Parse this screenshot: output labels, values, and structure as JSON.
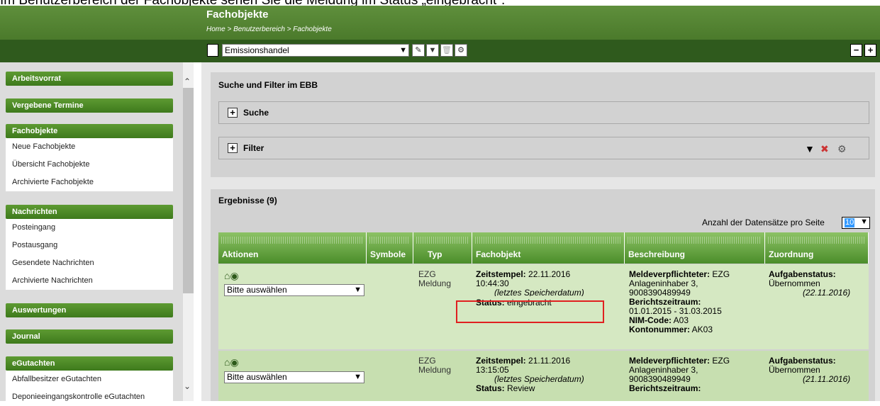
{
  "caption": "Im Benutzerbereich der Fachobjekte sehen Sie die Meldung im Status „eingebracht\".",
  "header": {
    "title": "Fachobjekte",
    "breadcrumb": "Home > Benutzerbereich > Fachobjekte"
  },
  "toolbar": {
    "selected": "Emissionshandel",
    "icons": [
      "document-icon",
      "edit-icon",
      "filter-icon",
      "trash-icon",
      "settings-icon"
    ],
    "right_icons": [
      "collapse-all-icon",
      "expand-all-icon"
    ]
  },
  "sidebar": {
    "groups": [
      {
        "title": "Arbeitsvorrat",
        "items": []
      },
      {
        "title": "Vergebene Termine",
        "items": []
      },
      {
        "title": "Fachobjekte",
        "items": [
          "Neue Fachobjekte",
          "Übersicht Fachobjekte",
          "Archivierte Fachobjekte"
        ]
      },
      {
        "title": "Nachrichten",
        "items": [
          "Posteingang",
          "Postausgang",
          "Gesendete Nachrichten",
          "Archivierte Nachrichten"
        ]
      },
      {
        "title": "Auswertungen",
        "items": []
      },
      {
        "title": "Journal",
        "items": []
      },
      {
        "title": "eGutachten",
        "items": [
          "Abfallbesitzer eGutachten",
          "Deponieeingangskontrolle eGutachten"
        ]
      }
    ]
  },
  "search_panel": {
    "title": "Suche und Filter im EBB",
    "search_label": "Suche",
    "filter_label": "Filter"
  },
  "results": {
    "title": "Ergebnisse (9)",
    "per_page_label": "Anzahl der Datensätze pro Seite",
    "per_page_value": "10",
    "columns": [
      "Aktionen",
      "Symbole",
      "Typ",
      "Fachobjekt",
      "Beschreibung",
      "Zuordnung"
    ],
    "rows": [
      {
        "action_select": "Bitte auswählen",
        "type_l1": "EZG",
        "type_l2": "Meldung",
        "ts_label": "Zeitstempel:",
        "ts_date": "22.11.2016",
        "ts_time": "10:44:30",
        "ts_note": "(letztes Speicherdatum)",
        "status_label": "Status:",
        "status_value": "eingebracht",
        "desc_mv_label": "Meldeverpflichteter:",
        "desc_mv_value": "EZG",
        "desc_l2": "Anlageninhaber 3,",
        "desc_l3": "9008390489949",
        "desc_bz_label": "Berichtszeitraum:",
        "desc_bz_value": "01.01.2015 - 31.03.2015",
        "desc_nim_label": "NIM-Code:",
        "desc_nim_value": "A03",
        "desc_kn_label": "Kontonummer:",
        "desc_kn_value": "AK03",
        "zu_label": "Aufgabenstatus:",
        "zu_value": "Übernommen",
        "zu_date": "(22.11.2016)"
      },
      {
        "action_select": "Bitte auswählen",
        "type_l1": "EZG",
        "type_l2": "Meldung",
        "ts_label": "Zeitstempel:",
        "ts_date": "21.11.2016",
        "ts_time": "13:15:05",
        "ts_note": "(letztes Speicherdatum)",
        "status_label": "Status:",
        "status_value": "Review",
        "desc_mv_label": "Meldeverpflichteter:",
        "desc_mv_value": "EZG",
        "desc_l2": "Anlageninhaber 3,",
        "desc_l3": "9008390489949",
        "desc_bz_label": "Berichtszeitraum:",
        "zu_label": "Aufgabenstatus:",
        "zu_value": "Übernommen",
        "zu_date": "(21.11.2016)"
      }
    ]
  }
}
